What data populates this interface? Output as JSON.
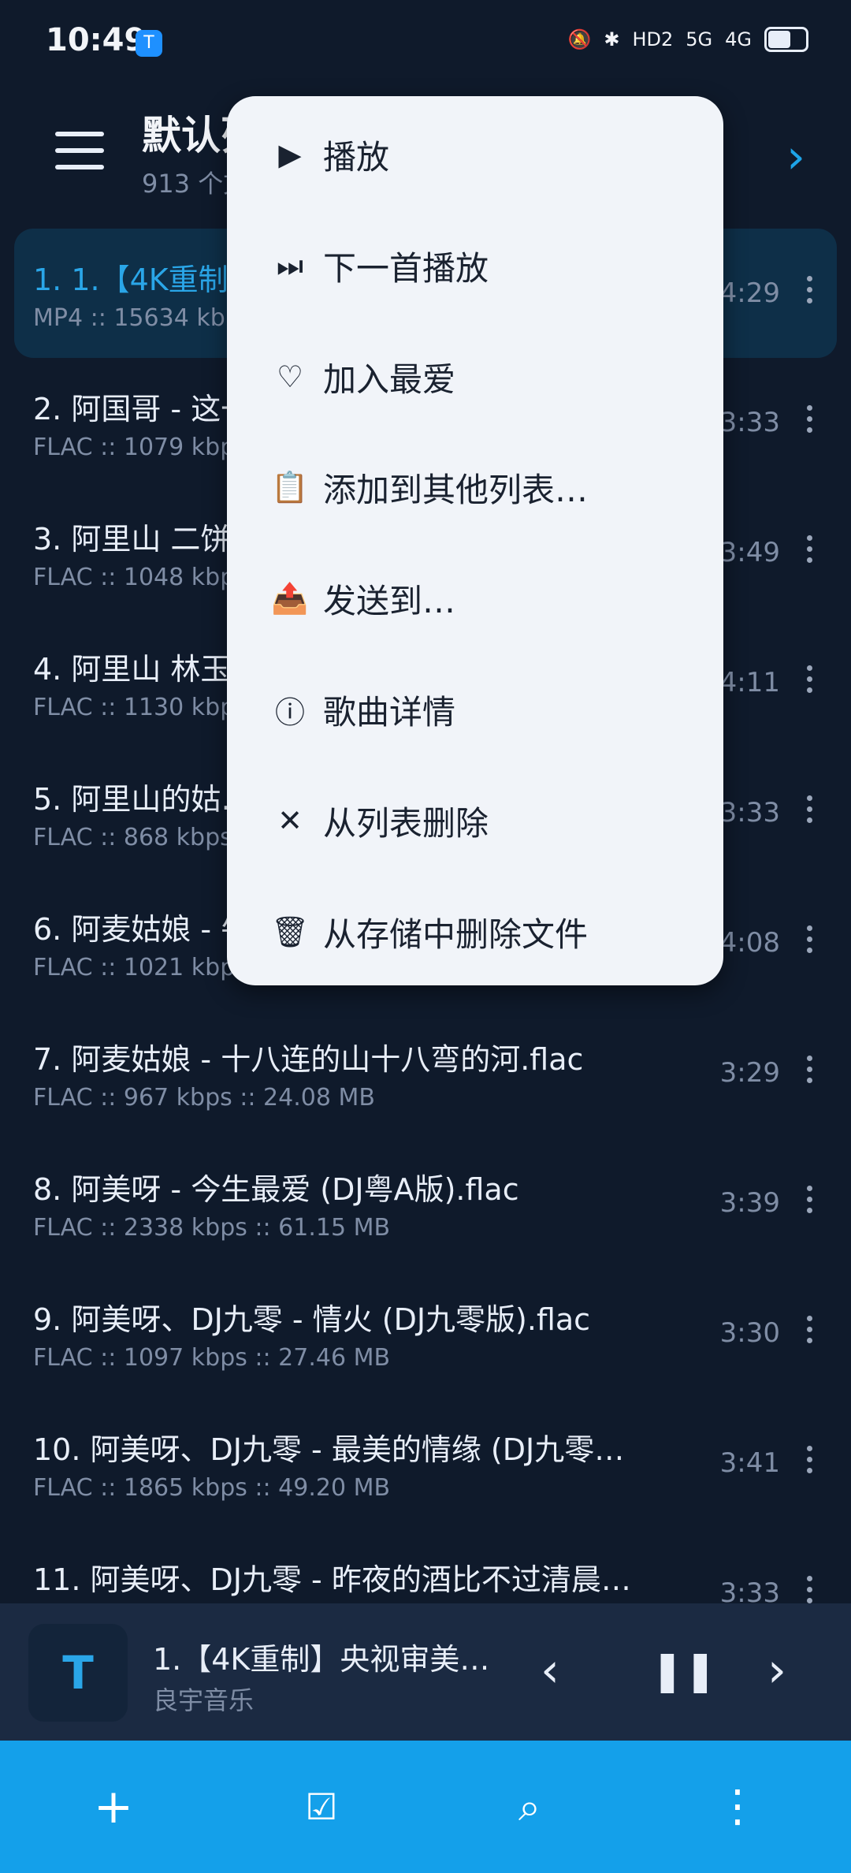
{
  "status": {
    "time": "10:49",
    "network": "4G",
    "network2": "5G",
    "hd": "HD2"
  },
  "header": {
    "title": "默认列表",
    "subtitle": "913 个文件"
  },
  "list": [
    {
      "title": "1. 1.【4K重制】央视审美…",
      "meta": "MP4 :: 15634 kbps",
      "duration": "4:29"
    },
    {
      "title": "2. 阿国哥 - 这一…",
      "meta": "FLAC :: 1079 kbps",
      "duration": "3:33"
    },
    {
      "title": "3. 阿里山 二饼…",
      "meta": "FLAC :: 1048 kbps",
      "duration": "3:49"
    },
    {
      "title": "4. 阿里山 林玉…",
      "meta": "FLAC :: 1130 kbps",
      "duration": "4:11"
    },
    {
      "title": "5. 阿里山的姑…",
      "meta": "FLAC :: 868 kbps",
      "duration": "3:33"
    },
    {
      "title": "6. 阿麦姑娘 - 牛…",
      "meta": "FLAC :: 1021 kbps",
      "duration": "4:08"
    },
    {
      "title": "7. 阿麦姑娘 - 十八连的山十八弯的河.flac",
      "meta": "FLAC :: 967 kbps :: 24.08 MB",
      "duration": "3:29"
    },
    {
      "title": "8. 阿美呀 - 今生最爱 (DJ粤A版).flac",
      "meta": "FLAC :: 2338 kbps :: 61.15 MB",
      "duration": "3:39"
    },
    {
      "title": "9. 阿美呀、DJ九零 - 情火 (DJ九零版).flac",
      "meta": "FLAC :: 1097 kbps :: 27.46 MB",
      "duration": "3:30"
    },
    {
      "title": "10. 阿美呀、DJ九零 - 最美的情缘 (DJ九零…",
      "meta": "FLAC :: 1865 kbps :: 49.20 MB",
      "duration": "3:41"
    },
    {
      "title": "11. 阿美呀、DJ九零 - 昨夜的酒比不过清晨…",
      "meta": "",
      "duration": "3:33"
    }
  ],
  "menu": [
    {
      "icon": "▶",
      "label": "播放"
    },
    {
      "icon": "⏭",
      "label": "下一首播放"
    },
    {
      "icon": "♡",
      "label": "加入最爱"
    },
    {
      "icon": "📋",
      "label": "添加到其他列表…"
    },
    {
      "icon": "📤",
      "label": "发送到…"
    },
    {
      "icon": "ⓘ",
      "label": "歌曲详情"
    },
    {
      "icon": "✕",
      "label": "从列表删除"
    },
    {
      "icon": "🗑",
      "label": "从存储中删除文件"
    }
  ],
  "now_playing": {
    "art_letter": "T",
    "title": "1.【4K重制】央视审美…",
    "artist": "良宇音乐"
  },
  "colors": {
    "accent": "#14a0ea",
    "background": "#0f1a2b",
    "menu_bg": "#f1f4f9"
  }
}
